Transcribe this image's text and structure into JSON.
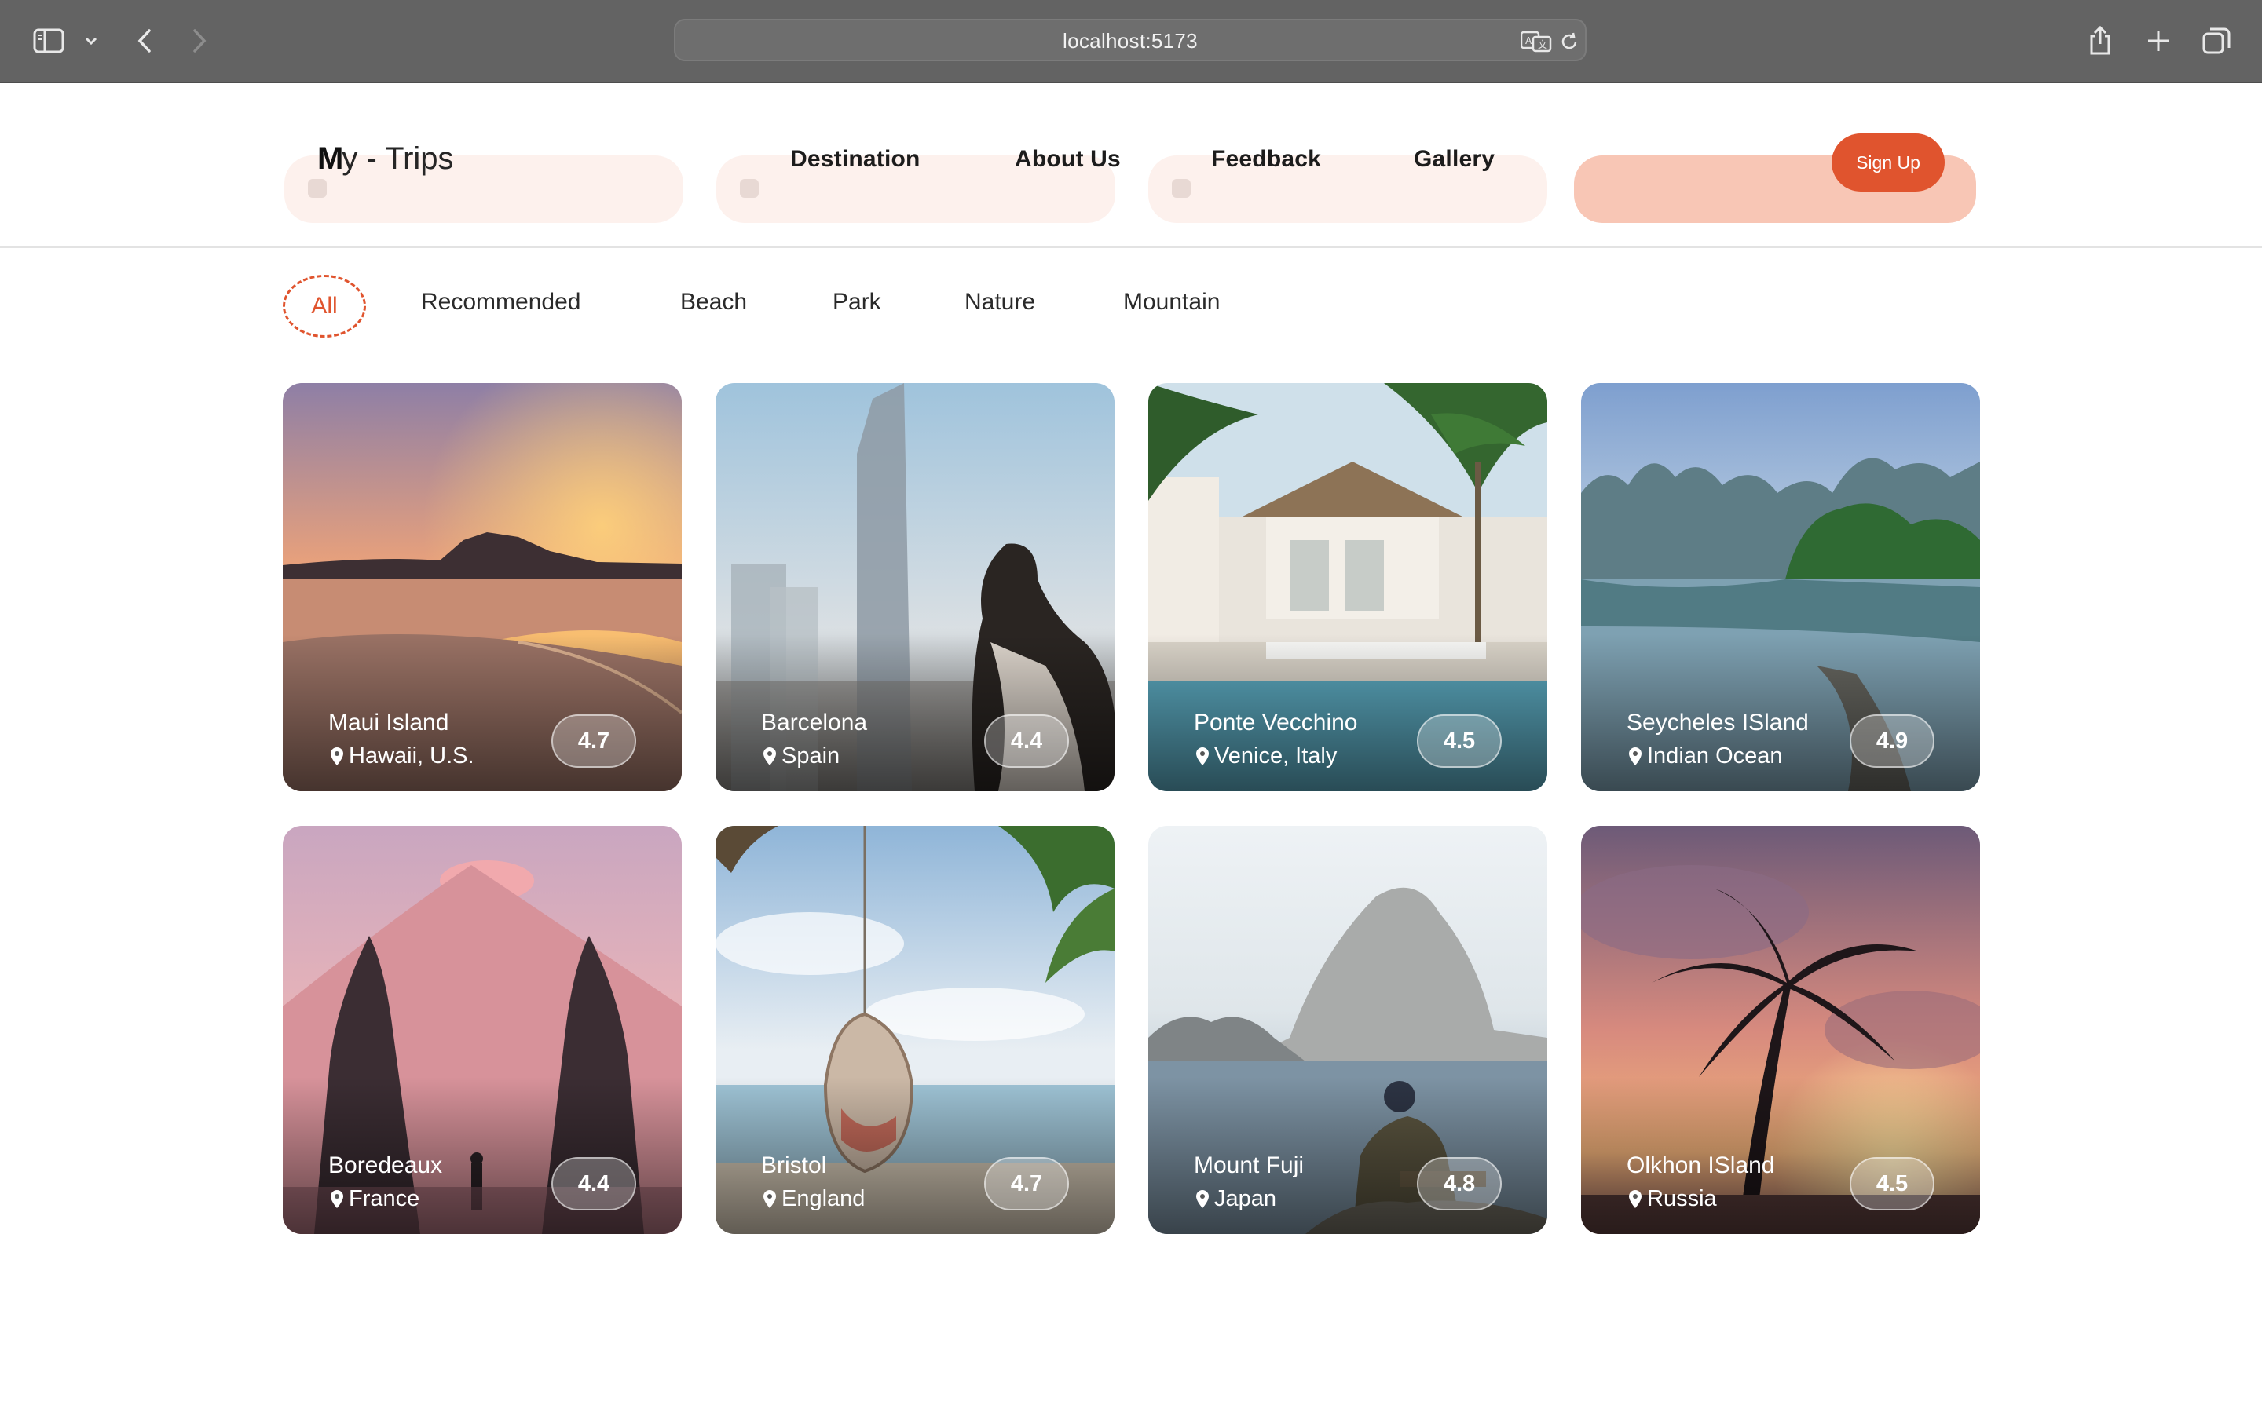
{
  "browser": {
    "url": "localhost:5173"
  },
  "nav": {
    "logo_mark": "M",
    "logo_text": "y - Trips",
    "links": [
      "Destination",
      "About Us",
      "Feedback",
      "Gallery"
    ],
    "signup_label": "Sign Up"
  },
  "filters": {
    "active": "All",
    "items": [
      "All",
      "Recommended",
      "Beach",
      "Park",
      "Nature",
      "Mountain"
    ]
  },
  "cards": [
    {
      "title": "Maui Island",
      "location": "Hawaii, U.S.",
      "rating": "4.7",
      "scene": "sunset beach with rocky island"
    },
    {
      "title": "Barcelona",
      "location": "Spain",
      "rating": "4.4",
      "scene": "woman on phone in front of skyscrapers"
    },
    {
      "title": "Ponte Vecchino",
      "location": "Venice, Italy",
      "rating": "4.5",
      "scene": "resort villa with pool and palm trees"
    },
    {
      "title": "Seycheles ISland",
      "location": "Indian Ocean",
      "rating": "4.9",
      "scene": "river with green karst mountains"
    },
    {
      "title": "Boredeaux",
      "location": "France",
      "rating": "4.4",
      "scene": "temple gate with mountain at dusk"
    },
    {
      "title": "Bristol",
      "location": "England",
      "rating": "4.7",
      "scene": "hanging swing chair at beach with palms"
    },
    {
      "title": "Mount Fuji",
      "location": "Japan",
      "rating": "4.8",
      "scene": "man sitting looking at rocky island"
    },
    {
      "title": "Olkhon ISland",
      "location": "Russia",
      "rating": "4.5",
      "scene": "palm tree silhouette at sunset"
    }
  ],
  "colors": {
    "accent": "#e0542e",
    "chrome": "#636363"
  },
  "icons": {
    "sidebar": "sidebar-icon",
    "back": "chevron-left-icon",
    "forward": "chevron-right-icon",
    "translate": "translate-icon",
    "reload": "reload-icon",
    "share": "share-icon",
    "new_tab": "plus-icon",
    "tabs": "tabs-overview-icon",
    "location_pin": "location-pin-icon"
  }
}
